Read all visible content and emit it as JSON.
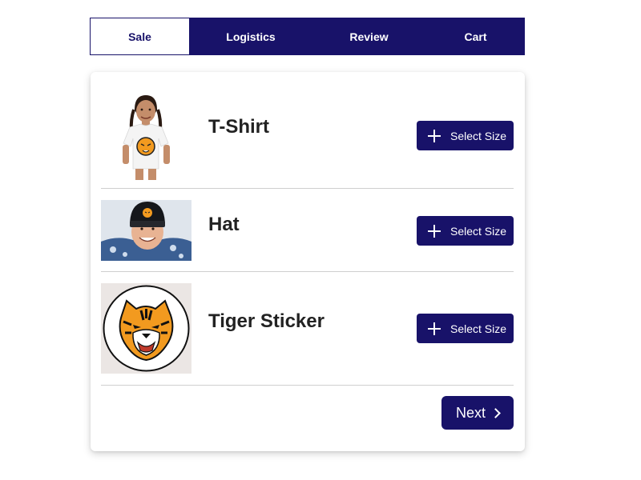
{
  "tabs": [
    {
      "label": "Sale",
      "active": true
    },
    {
      "label": "Logistics",
      "active": false
    },
    {
      "label": "Review",
      "active": false
    },
    {
      "label": "Cart",
      "active": false
    }
  ],
  "products": [
    {
      "name": "T-Shirt",
      "button_label": "Select Size",
      "image": "girl-in-tiger-tshirt"
    },
    {
      "name": "Hat",
      "button_label": "Select Size",
      "image": "boy-in-tiger-beanie"
    },
    {
      "name": "Tiger Sticker",
      "button_label": "Select Size",
      "image": "tiger-head-sticker"
    }
  ],
  "footer": {
    "next_label": "Next"
  },
  "colors": {
    "primary": "#181269",
    "divider": "#cfcfcf",
    "tiger_orange": "#f29a1f"
  },
  "icons": [
    "plus-icon",
    "chevron-right-icon"
  ]
}
